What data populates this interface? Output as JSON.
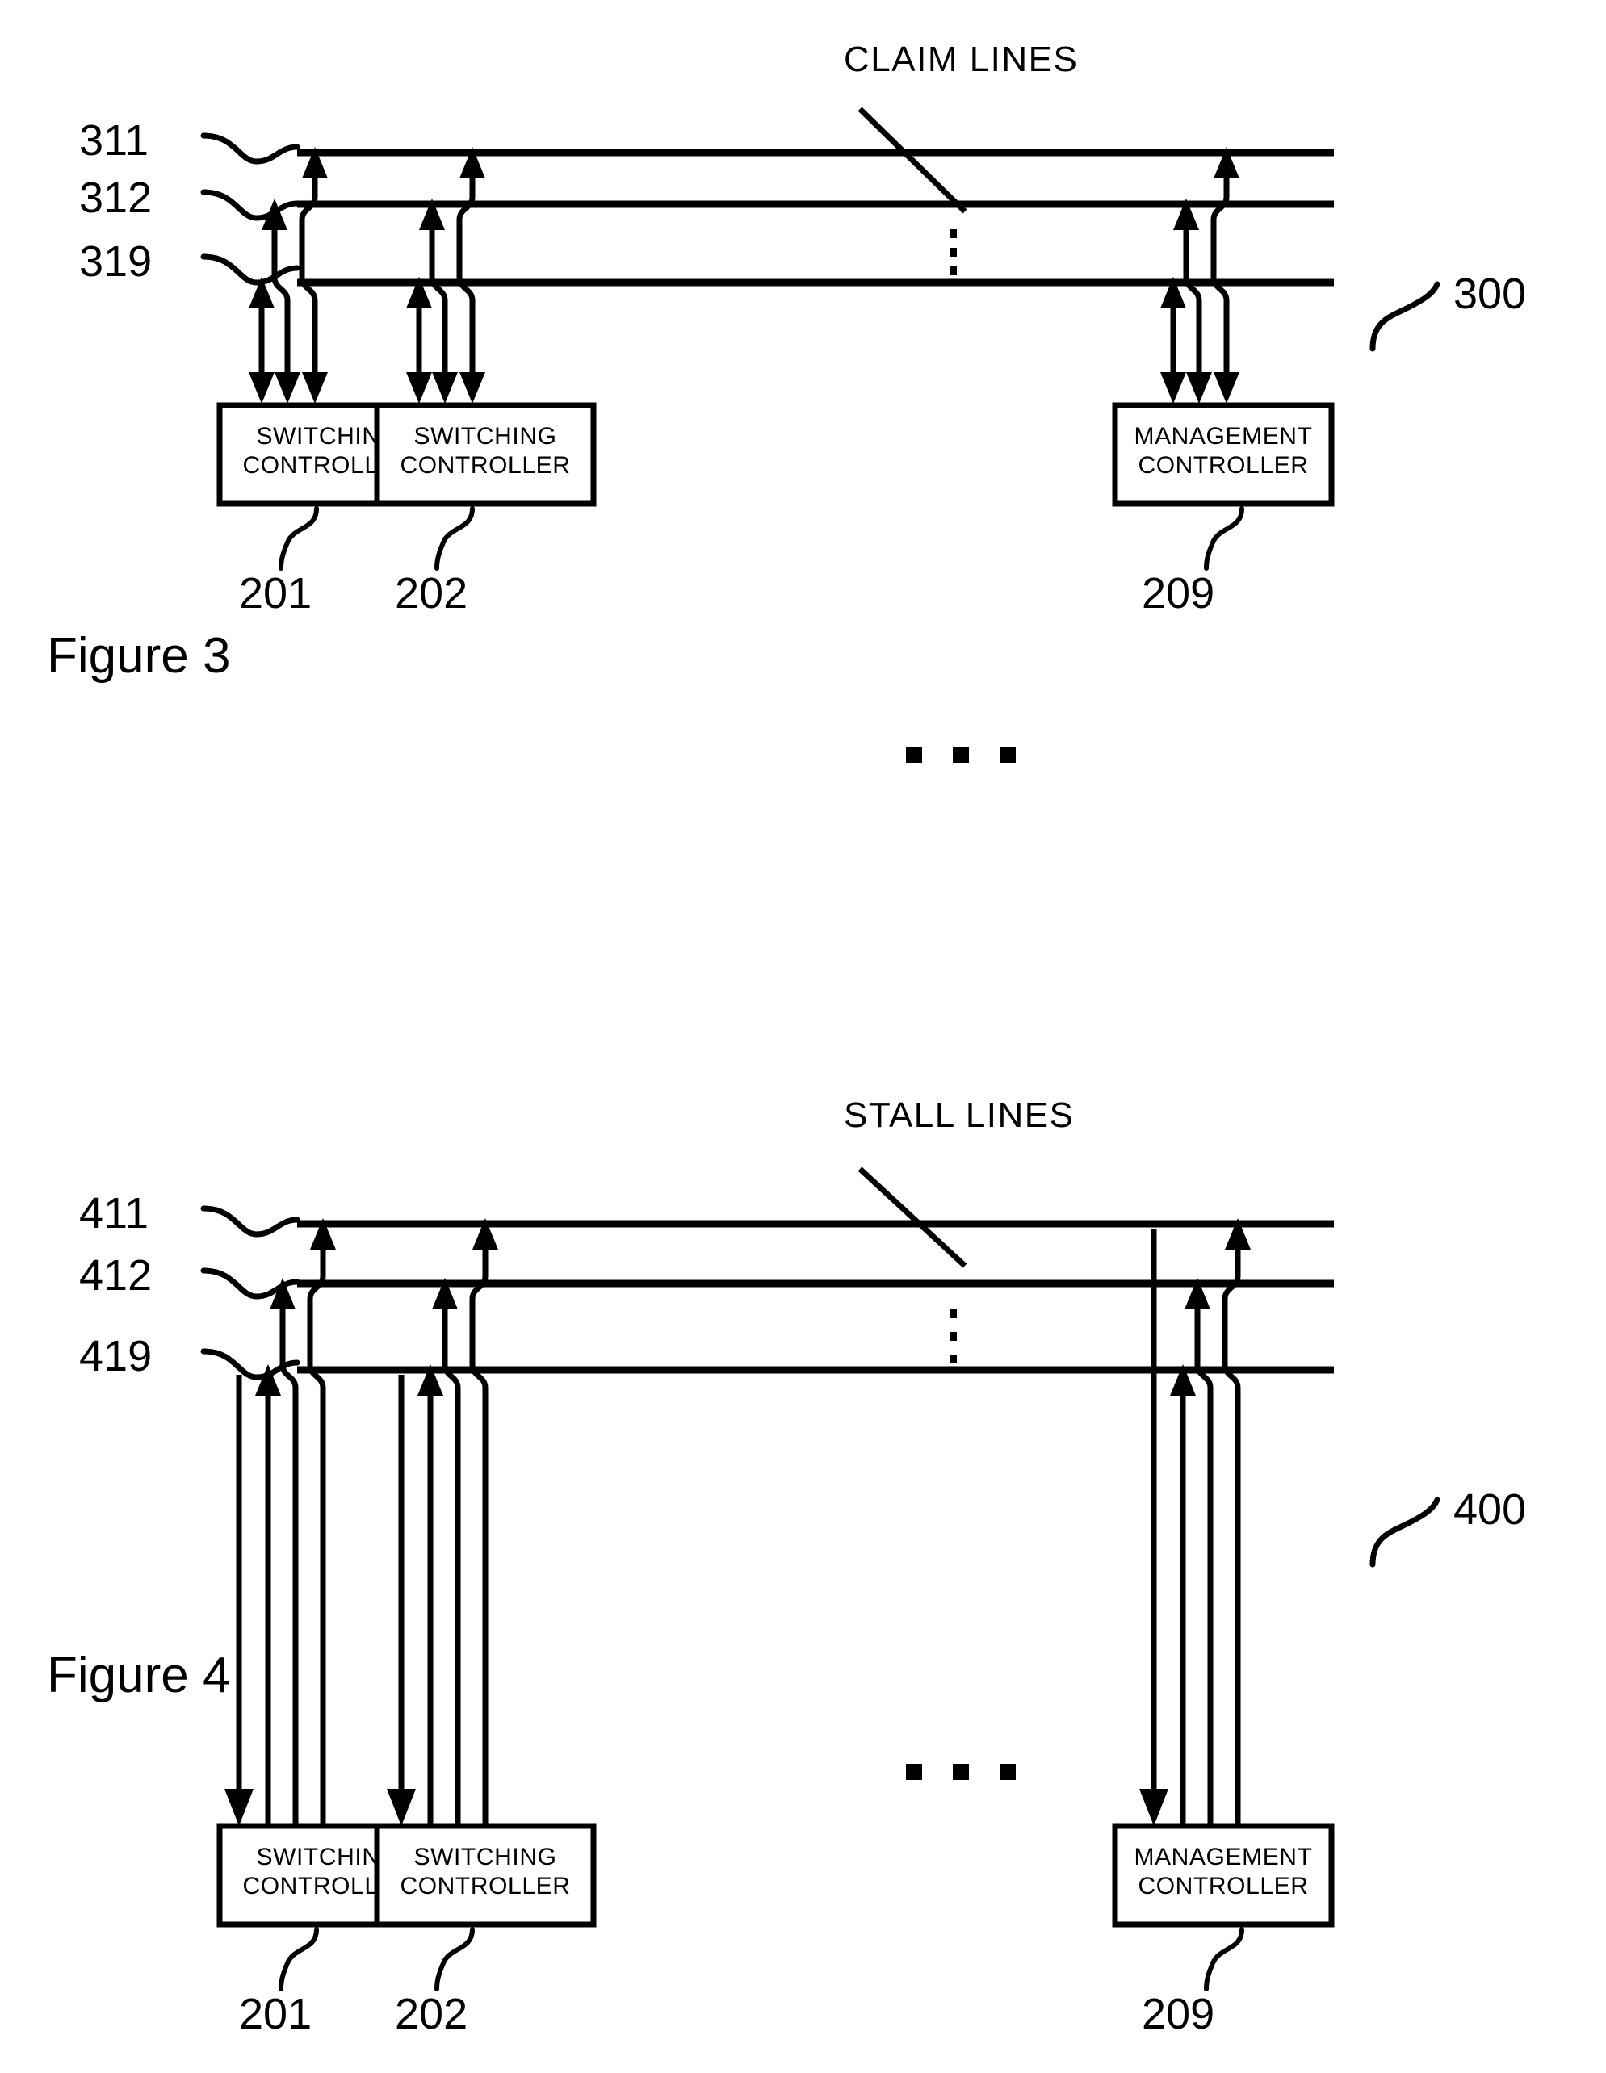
{
  "document": {
    "type": "patent-drawing-sheet",
    "figures": [
      {
        "id": "figure-3",
        "caption": "Figure 3",
        "bus_group_label": "CLAIM  LINES",
        "bus_group_ref": "300",
        "bus_lines": [
          {
            "ref": "311"
          },
          {
            "ref": "312"
          },
          {
            "ref": "319"
          }
        ],
        "vertical_ellipsis": "⋮",
        "horizontal_ellipsis": "• • •",
        "blocks": [
          {
            "ref": "201",
            "line1": "SWITCHING",
            "line2": "CONTROLLER"
          },
          {
            "ref": "202",
            "line1": "SWITCHING",
            "line2": "CONTROLLER"
          },
          {
            "ref": "209",
            "line1": "MANAGEMENT",
            "line2": "CONTROLLER"
          }
        ]
      },
      {
        "id": "figure-4",
        "caption": "Figure 4",
        "bus_group_label": "STALL LINES",
        "bus_group_ref": "400",
        "bus_lines": [
          {
            "ref": "411"
          },
          {
            "ref": "412"
          },
          {
            "ref": "419"
          }
        ],
        "vertical_ellipsis": "⋮",
        "horizontal_ellipsis": "• • •",
        "blocks": [
          {
            "ref": "201",
            "line1": "SWITCHING",
            "line2": "CONTROLLER"
          },
          {
            "ref": "202",
            "line1": "SWITCHING",
            "line2": "CONTROLLER"
          },
          {
            "ref": "209",
            "line1": "MANAGEMENT",
            "line2": "CONTROLLER"
          }
        ]
      }
    ],
    "colors": {
      "ink": "#000000",
      "paper": "#ffffff"
    }
  }
}
